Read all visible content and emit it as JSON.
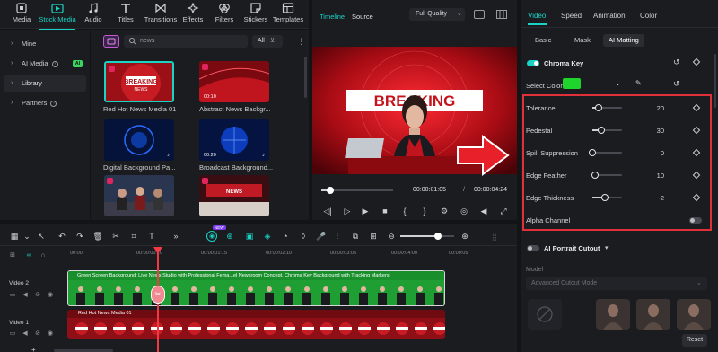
{
  "toolbar": {
    "items": [
      {
        "label": "Media",
        "icon": "media-icon"
      },
      {
        "label": "Stock Media",
        "icon": "stock-media-icon"
      },
      {
        "label": "Audio",
        "icon": "audio-icon"
      },
      {
        "label": "Titles",
        "icon": "titles-icon"
      },
      {
        "label": "Transitions",
        "icon": "transitions-icon"
      },
      {
        "label": "Effects",
        "icon": "effects-icon"
      },
      {
        "label": "Filters",
        "icon": "filters-icon"
      },
      {
        "label": "Stickers",
        "icon": "stickers-icon"
      },
      {
        "label": "Templates",
        "icon": "templates-icon"
      }
    ],
    "active": "Stock Media",
    "accent": "#19d3c5"
  },
  "sidebar": {
    "items": [
      {
        "label": "Mine"
      },
      {
        "label": "AI Media",
        "badge": "AI"
      },
      {
        "label": "Library"
      },
      {
        "label": "Partners"
      }
    ]
  },
  "media": {
    "search_value": "news",
    "filter_label": "All",
    "items": [
      {
        "title": "Red Hot News Media 01",
        "duration": ""
      },
      {
        "title": "Abstract News Backgr...",
        "duration": "00:10"
      },
      {
        "title": "Digital Background Pa...",
        "duration": ""
      },
      {
        "title": "Broadcast Background...",
        "duration": "00:20"
      },
      {
        "title": "",
        "duration": ""
      },
      {
        "title": "",
        "duration": ""
      }
    ]
  },
  "preview": {
    "tab_timeline": "Timeline",
    "tab_source": "Source",
    "quality": "Full Quality",
    "current_time": "00:00:01:05",
    "separator": "/",
    "total_time": "00:00:04:24",
    "playhead_fraction": 0.12,
    "video_banner_text": "BREAKING"
  },
  "right_panel": {
    "tabs": [
      "Video",
      "Speed",
      "Animation",
      "Color"
    ],
    "active_tab": "Video",
    "sub_tabs": [
      "Basic",
      "Mask",
      "AI Matting"
    ],
    "active_sub_tab": "AI Matting",
    "chroma_key_label": "Chroma Key",
    "chroma_key_on": true,
    "select_color_label": "Select Color",
    "selected_color": "#1fd42c",
    "params": [
      {
        "label": "Tolerance",
        "value": "20",
        "level": 0.2
      },
      {
        "label": "Pedestal",
        "value": "30",
        "level": 0.3
      },
      {
        "label": "Spill Suppression",
        "value": "0",
        "level": 0.0
      },
      {
        "label": "Edge Feather",
        "value": "10",
        "level": 0.1
      },
      {
        "label": "Edge Thickness",
        "value": "-2",
        "level": 0.43
      }
    ],
    "alpha_channel_label": "Alpha Channel",
    "alpha_channel_on": false,
    "highlight_color": "#e0303a",
    "ai_portrait_label": "AI Portrait Cutout",
    "model_label": "Model",
    "model_value": "Advanced Cutout Mode",
    "reset_label": "Reset"
  },
  "timeline": {
    "ticks": [
      "00:00",
      "00:00:00:20",
      "00:00:01:15",
      "00:00:02:10",
      "00:00:03:05",
      "00:00:04:00",
      "00:00:05"
    ],
    "tracks": [
      {
        "label": "Video 2",
        "clip_title": "Green Screen Background: Live News Studio with Professional Fema...el Newsroom Concept. Chroma Key Background with Tracking Markers",
        "color": "#22b83a"
      },
      {
        "label": "Video 1",
        "clip_title": "Red Hot News Media 01",
        "color": "#a11820"
      }
    ],
    "badge_new": "NEW"
  }
}
